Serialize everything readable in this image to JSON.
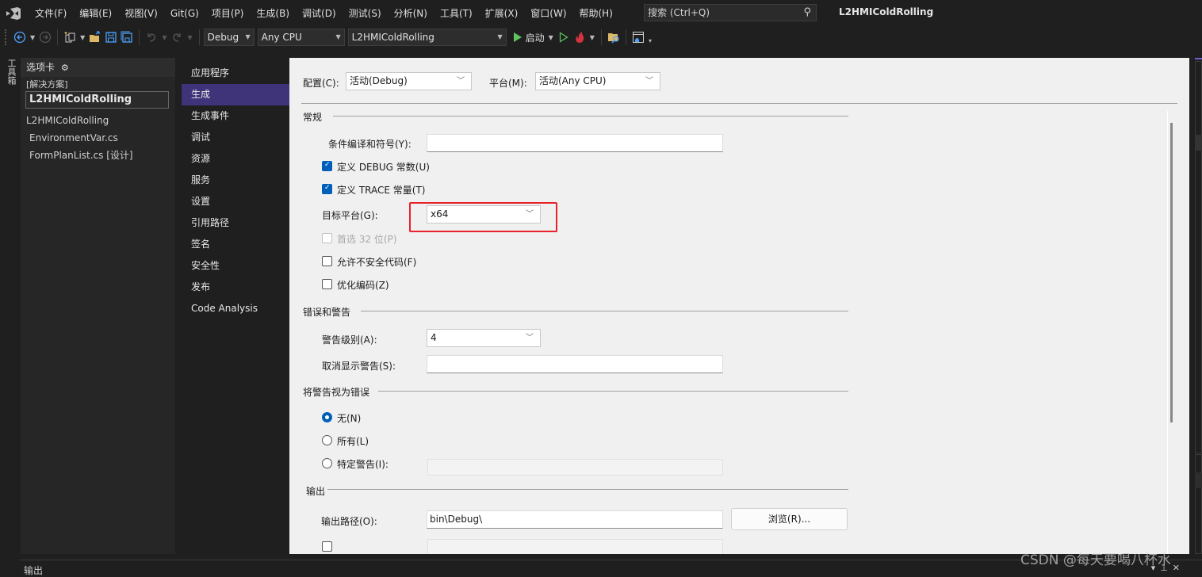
{
  "menubar": {
    "items": [
      "文件(F)",
      "编辑(E)",
      "视图(V)",
      "Git(G)",
      "项目(P)",
      "生成(B)",
      "调试(D)",
      "测试(S)",
      "分析(N)",
      "工具(T)",
      "扩展(X)",
      "窗口(W)",
      "帮助(H)"
    ],
    "search_placeholder": "搜索 (Ctrl+Q)",
    "window_title": "L2HMIColdRolling"
  },
  "toolbar": {
    "config_value": "Debug",
    "platform_value": "Any CPU",
    "project_value": "L2HMIColdRolling",
    "start_label": "启动"
  },
  "toolbox_tab": "工具箱",
  "left_panel": {
    "header": "选项卡",
    "group_label": "[解决方案]",
    "selected_item": "L2HMIColdRolling",
    "items": [
      "L2HMIColdRolling",
      "EnvironmentVar.cs",
      "FormPlanList.cs [设计]"
    ]
  },
  "settings_nav": {
    "items": [
      "应用程序",
      "生成",
      "生成事件",
      "调试",
      "资源",
      "服务",
      "设置",
      "引用路径",
      "签名",
      "安全性",
      "发布",
      "Code Analysis"
    ],
    "active_index": 1
  },
  "content": {
    "config_label": "配置(C):",
    "config_value": "活动(Debug)",
    "platform_label": "平台(M):",
    "platform_value": "活动(Any CPU)",
    "general": {
      "title": "常规",
      "conditional_symbols_label": "条件编译和符号(Y):",
      "conditional_symbols_value": "",
      "define_debug_label": "定义 DEBUG 常数(U)",
      "define_debug_checked": true,
      "define_trace_label": "定义 TRACE 常量(T)",
      "define_trace_checked": true,
      "target_platform_label": "目标平台(G):",
      "target_platform_value": "x64",
      "prefer32_label": "首选 32 位(P)",
      "prefer32_checked": false,
      "allow_unsafe_label": "允许不安全代码(F)",
      "allow_unsafe_checked": false,
      "optimize_label": "优化编码(Z)",
      "optimize_checked": false
    },
    "errors": {
      "title": "错误和警告",
      "warning_level_label": "警告级别(A):",
      "warning_level_value": "4",
      "suppress_label": "取消显示警告(S):",
      "suppress_value": ""
    },
    "treat_warnings": {
      "title": "将警告视为错误",
      "options": [
        "无(N)",
        "所有(L)",
        "特定警告(I):"
      ],
      "selected_index": 0,
      "specific_value": ""
    },
    "output": {
      "title": "输出",
      "path_label": "输出路径(O):",
      "path_value": "bin\\Debug\\",
      "browse_label": "浏览(R)..."
    }
  },
  "output_panel": {
    "title": "输出"
  },
  "watermark": "CSDN @每天要喝八杯水"
}
